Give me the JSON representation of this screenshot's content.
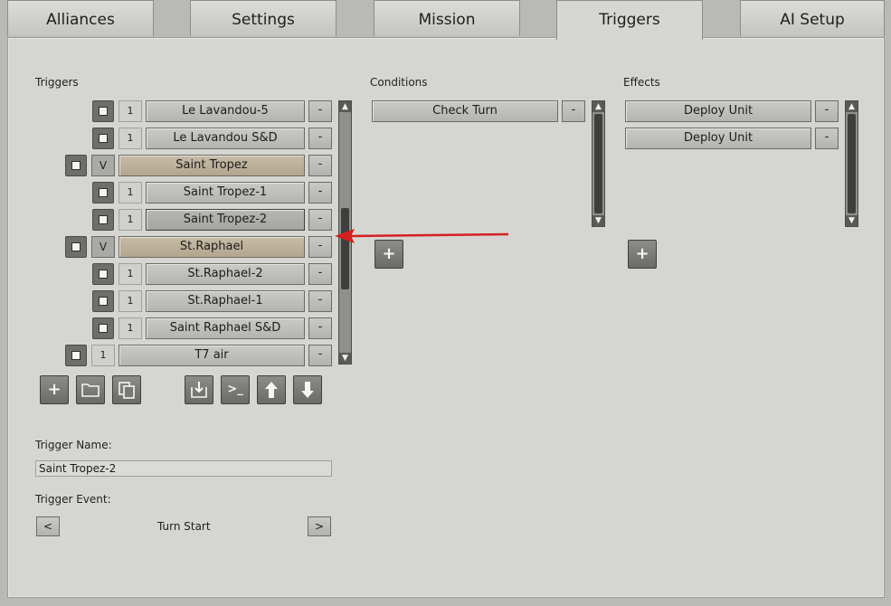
{
  "tabs": [
    {
      "label": "Alliances",
      "active": false
    },
    {
      "label": "Settings",
      "active": false
    },
    {
      "label": "Mission",
      "active": false
    },
    {
      "label": "Triggers",
      "active": true
    },
    {
      "label": "AI Setup",
      "active": false
    }
  ],
  "triggers": {
    "label": "Triggers",
    "items": [
      {
        "name": "Le Lavandou-5",
        "count": "1",
        "kind": "item"
      },
      {
        "name": "Le Lavandou S&D",
        "count": "1",
        "kind": "item"
      },
      {
        "name": "Saint Tropez",
        "count": "V",
        "kind": "group"
      },
      {
        "name": "Saint Tropez-1",
        "count": "1",
        "kind": "item"
      },
      {
        "name": "Saint Tropez-2",
        "count": "1",
        "kind": "selected"
      },
      {
        "name": "St.Raphael",
        "count": "V",
        "kind": "group"
      },
      {
        "name": "St.Raphael-2",
        "count": "1",
        "kind": "item"
      },
      {
        "name": "St.Raphael-1",
        "count": "1",
        "kind": "item"
      },
      {
        "name": "Saint Raphael S&D",
        "count": "1",
        "kind": "item"
      },
      {
        "name": "T7 air",
        "count": "1",
        "kind": "toplevel"
      }
    ],
    "minus_label": "-",
    "toolbar": [
      "add-icon",
      "folder-icon",
      "copy-icon",
      "import-icon",
      "console-icon",
      "move-up-icon",
      "move-down-icon"
    ]
  },
  "conditions": {
    "label": "Conditions",
    "items": [
      {
        "name": "Check Turn"
      }
    ],
    "minus_label": "-"
  },
  "effects": {
    "label": "Effects",
    "items": [
      {
        "name": "Deploy Unit"
      },
      {
        "name": "Deploy Unit"
      }
    ],
    "minus_label": "-"
  },
  "trigger_name": {
    "label": "Trigger Name:",
    "value": "Saint Tropez-2"
  },
  "trigger_event": {
    "label": "Trigger Event:",
    "value": "Turn Start",
    "prev": "<",
    "next": ">"
  },
  "colors": {
    "annotation_arrow": "#d42020",
    "group_row": "#b9ad96"
  }
}
